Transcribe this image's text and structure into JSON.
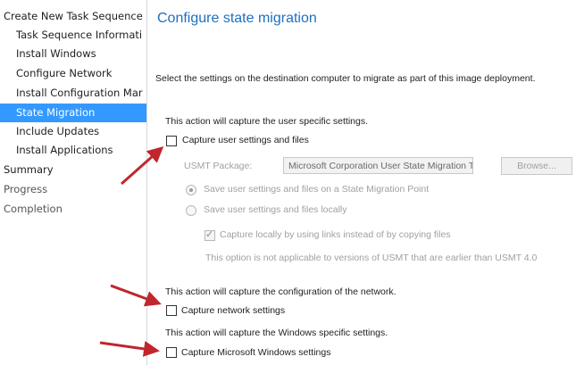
{
  "sidebar": {
    "items": [
      {
        "label": "Create New Task Sequence"
      },
      {
        "label": "Task Sequence Informati"
      },
      {
        "label": "Install Windows"
      },
      {
        "label": "Configure Network"
      },
      {
        "label": "Install Configuration Mar"
      },
      {
        "label": "State Migration"
      },
      {
        "label": "Include Updates"
      },
      {
        "label": "Install Applications"
      },
      {
        "label": "Summary"
      },
      {
        "label": "Progress"
      },
      {
        "label": "Completion"
      }
    ]
  },
  "main": {
    "title": "Configure state migration",
    "instructions": "Select the settings on the destination computer to migrate as part of this image deployment.",
    "user_section": {
      "description": "This action will capture the user specific settings.",
      "capture_label": "Capture user settings and files",
      "capture_checked": false,
      "usmt_label": "USMT Package:",
      "usmt_value": "Microsoft Corporation User State Migration Too",
      "browse_label": "Browse...",
      "option_smp": "Save user settings and files on a State Migration Point",
      "option_local": "Save user settings and files locally",
      "links_label": "Capture locally by using links instead of by copying files",
      "note": "This option is not applicable to versions of USMT that are earlier than USMT 4.0"
    },
    "network_section": {
      "description": "This action will capture the configuration of the network.",
      "capture_label": "Capture network settings",
      "capture_checked": false
    },
    "windows_section": {
      "description": "This action will capture the Windows specific settings.",
      "capture_label": "Capture Microsoft Windows settings",
      "capture_checked": false
    }
  },
  "colors": {
    "accent": "#3399ff",
    "title": "#1f6fbf",
    "arrow": "#c0262c"
  }
}
